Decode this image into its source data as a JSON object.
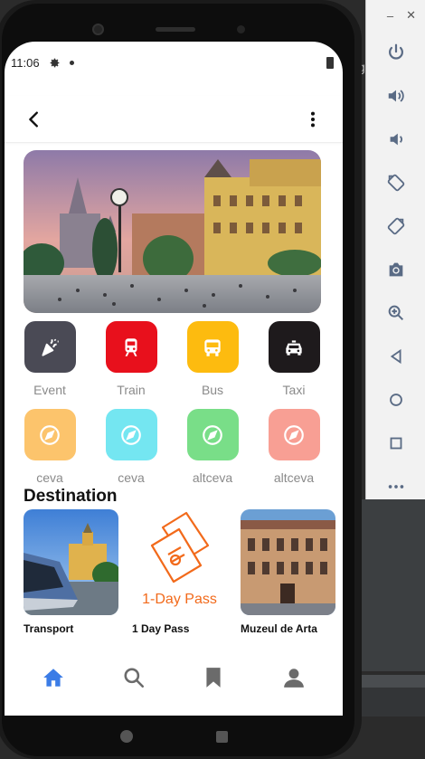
{
  "status_bar": {
    "time": "11:06"
  },
  "categories": [
    {
      "label": "Event",
      "icon": "party-popper-icon",
      "color": "#4a4a55"
    },
    {
      "label": "Train",
      "icon": "train-icon",
      "color": "#e8101c"
    },
    {
      "label": "Bus",
      "icon": "bus-icon",
      "color": "#fdbb0f"
    },
    {
      "label": "Taxi",
      "icon": "taxi-icon",
      "color": "#1e1a1c"
    },
    {
      "label": "ceva",
      "icon": "compass-icon",
      "color": "#fcc46c"
    },
    {
      "label": "ceva",
      "icon": "compass-icon",
      "color": "#74e6f1"
    },
    {
      "label": "altceva",
      "icon": "compass-icon",
      "color": "#79de88"
    },
    {
      "label": "altceva",
      "icon": "compass-icon",
      "color": "#f89f94"
    }
  ],
  "destination": {
    "title": "Destination",
    "items": [
      {
        "label": "Transport"
      },
      {
        "label": "1 Day Pass",
        "image_text": "1-Day Pass"
      },
      {
        "label": "Muzeul de Arta"
      }
    ]
  },
  "bottom_nav": {
    "items": [
      "home-icon",
      "search-icon",
      "bookmark-icon",
      "profile-icon"
    ],
    "active_color": "#3b7ce6",
    "inactive_color": "#6b6b6b"
  },
  "accent_colors": {
    "pass_orange": "#f26a1b"
  }
}
